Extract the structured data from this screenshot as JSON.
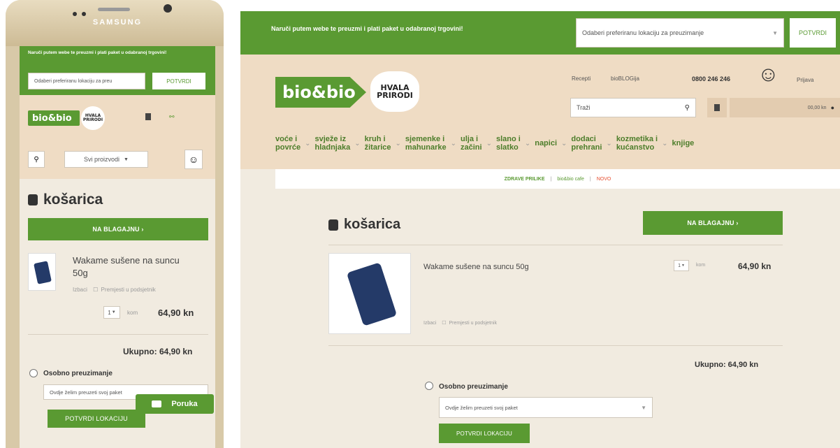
{
  "mobile": {
    "brand": "SAMSUNG",
    "promo_text": "Naruči putem webe te preuzmi i plati paket u odabranoj trgovini!",
    "location_select": "Odaberi preferiranu lokaciju za preu",
    "confirm_label": "POTVRDI",
    "logo_text": "bio&bio",
    "hvala_line1": "HVALA",
    "hvala_line2": "PRIRODI",
    "all_products": "Svi proizvodi",
    "cart_title": "košarica",
    "checkout_label": "NA BLAGAJNU ›",
    "item_name": "Wakame sušene na suncu 50g",
    "remove_label": "Izbaci",
    "move_label": "Premjesti u podsjetnik",
    "qty": "1",
    "unit": "kom",
    "price": "64,90 kn",
    "total": "Ukupno: 64,90 kn",
    "pickup_label": "Osobno preuzimanje",
    "pickup_select": "Ovdje želim preuzeti svoj paket",
    "confirm_location": "POTVRDI LOKACIJU",
    "message_label": "Poruka"
  },
  "desktop": {
    "promo_text": "Naruči putem webe te preuzmi i plati paket u odabranoj trgovini!",
    "location_select": "Odaberi preferiranu lokaciju za preuzimanje",
    "confirm_label": "POTVRDI",
    "logo_text": "bio&bio",
    "hvala_line1": "HVALA",
    "hvala_line2": "PRIRODI",
    "top_links": [
      "Recepti",
      "bioBLOGija"
    ],
    "phone": "0800 246 246",
    "login": "Prijava",
    "search_placeholder": "Traži",
    "cart_summary": "00,00 kn",
    "nav": [
      [
        "voće i",
        "povrće"
      ],
      [
        "svježe iz",
        "hladnjaka"
      ],
      [
        "kruh i",
        "žitarice"
      ],
      [
        "sjemenke i",
        "mahunarke"
      ],
      [
        "ulja i",
        "začini"
      ],
      [
        "slano i",
        "slatko"
      ],
      [
        "napici",
        ""
      ],
      [
        "dodaci",
        "prehrani"
      ],
      [
        "kozmetika i",
        "kućanstvo"
      ],
      [
        "knjige",
        ""
      ]
    ],
    "sub_links": [
      "ZDRAVE PRILIKE",
      "bio&bio cafe",
      "NOVO"
    ],
    "cart_title": "košarica",
    "checkout_label": "NA BLAGAJNU ›",
    "item_name": "Wakame sušene na suncu 50g",
    "remove_label": "Izbaci",
    "move_label": "Premjesti u podsjetnik",
    "qty": "1",
    "unit": "kom",
    "price": "64,90 kn",
    "total": "Ukupno: 64,90 kn",
    "pickup_label": "Osobno preuzimanje",
    "pickup_select": "Ovdje želim preuzeti svoj paket",
    "confirm_location": "POTVRDI LOKACIJU"
  },
  "colors": {
    "green": "#5a9a32",
    "tan": "#efdcc4",
    "cream": "#f1ebe0"
  },
  "icons": [
    "search-icon",
    "basket-icon",
    "user-icon",
    "mail-icon",
    "chevron-down-icon",
    "radio-icon"
  ]
}
